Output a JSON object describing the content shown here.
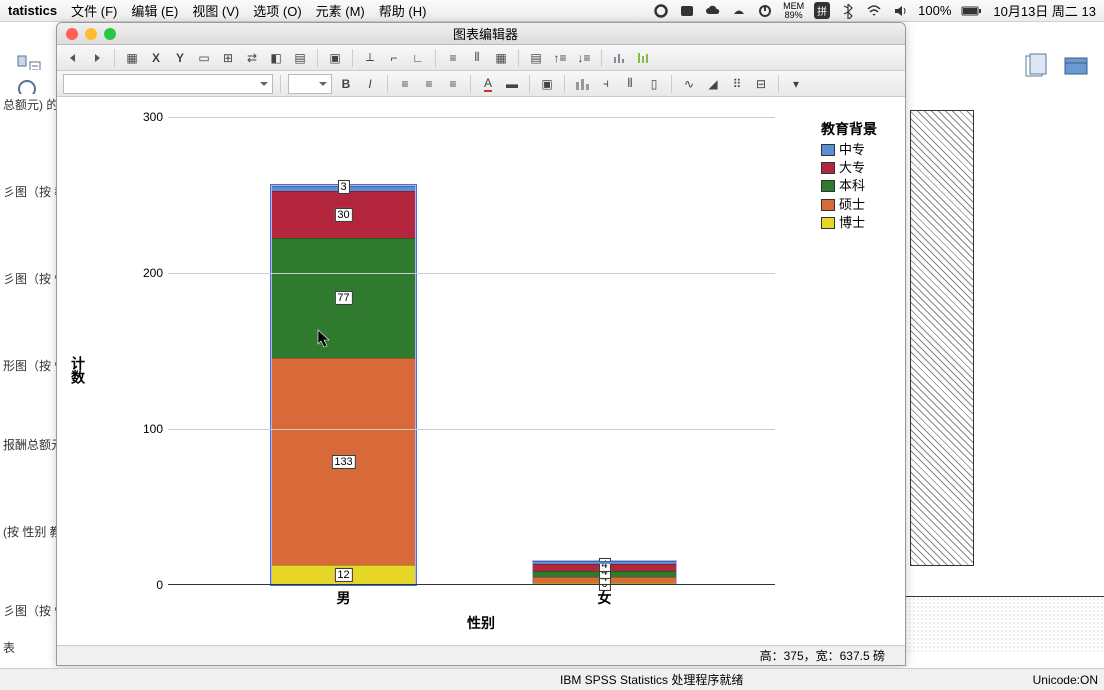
{
  "menubar": {
    "app": "tatistics",
    "items": [
      "文件 (F)",
      "编辑 (E)",
      "视图 (V)",
      "选项 (O)",
      "元素 (M)",
      "帮助 (H)"
    ],
    "battery": "100%",
    "mem_label": "MEM",
    "mem_value": "89%",
    "date": "10月13日 周二 13"
  },
  "editor": {
    "title": "图表编辑器",
    "status": "高：375，宽：637.5 磅",
    "font_select": "",
    "family_select": ""
  },
  "sidebar": {
    "items": [
      "总额元) 的",
      "",
      "彡图（按 教",
      "",
      "彡图（按 性",
      "",
      "形图（按 性",
      "",
      "报酬总额元",
      "",
      "(按 性别 教",
      "",
      "彡图（按 性",
      "表"
    ]
  },
  "legend": {
    "title": "教育背景",
    "items": [
      {
        "label": "中专",
        "color": "#5a8fd4"
      },
      {
        "label": "大专",
        "color": "#b3263e"
      },
      {
        "label": "本科",
        "color": "#2f7a2f"
      },
      {
        "label": "硕士",
        "color": "#d86a3a"
      },
      {
        "label": "博士",
        "color": "#e6d628"
      }
    ]
  },
  "axes": {
    "x": "性别",
    "y": "计数",
    "ticks": [
      0,
      100,
      200,
      300
    ],
    "ymax": 300
  },
  "categories": [
    "男",
    "女"
  ],
  "statusbar": {
    "mid": "IBM SPSS Statistics 处理程序就绪",
    "unicode": "Unicode:ON"
  },
  "chart_data": {
    "type": "bar",
    "stacked": true,
    "title": "",
    "xlabel": "性别",
    "ylabel": "计数",
    "ylim": [
      0,
      300
    ],
    "categories": [
      "男",
      "女"
    ],
    "series": [
      {
        "name": "博士",
        "color": "#e6d628",
        "values": [
          12,
          0
        ]
      },
      {
        "name": "硕士",
        "color": "#d86a3a",
        "values": [
          133,
          4
        ]
      },
      {
        "name": "本科",
        "color": "#2f7a2f",
        "values": [
          77,
          4
        ]
      },
      {
        "name": "大专",
        "color": "#b3263e",
        "values": [
          30,
          4
        ]
      },
      {
        "name": "中专",
        "color": "#5a8fd4",
        "values": [
          3,
          2
        ]
      }
    ],
    "labels_shown": {
      "男": [
        12,
        133,
        77,
        30,
        3
      ],
      "女": [
        0,
        4
      ]
    },
    "legend_title": "教育背景",
    "legend_position": "right"
  }
}
